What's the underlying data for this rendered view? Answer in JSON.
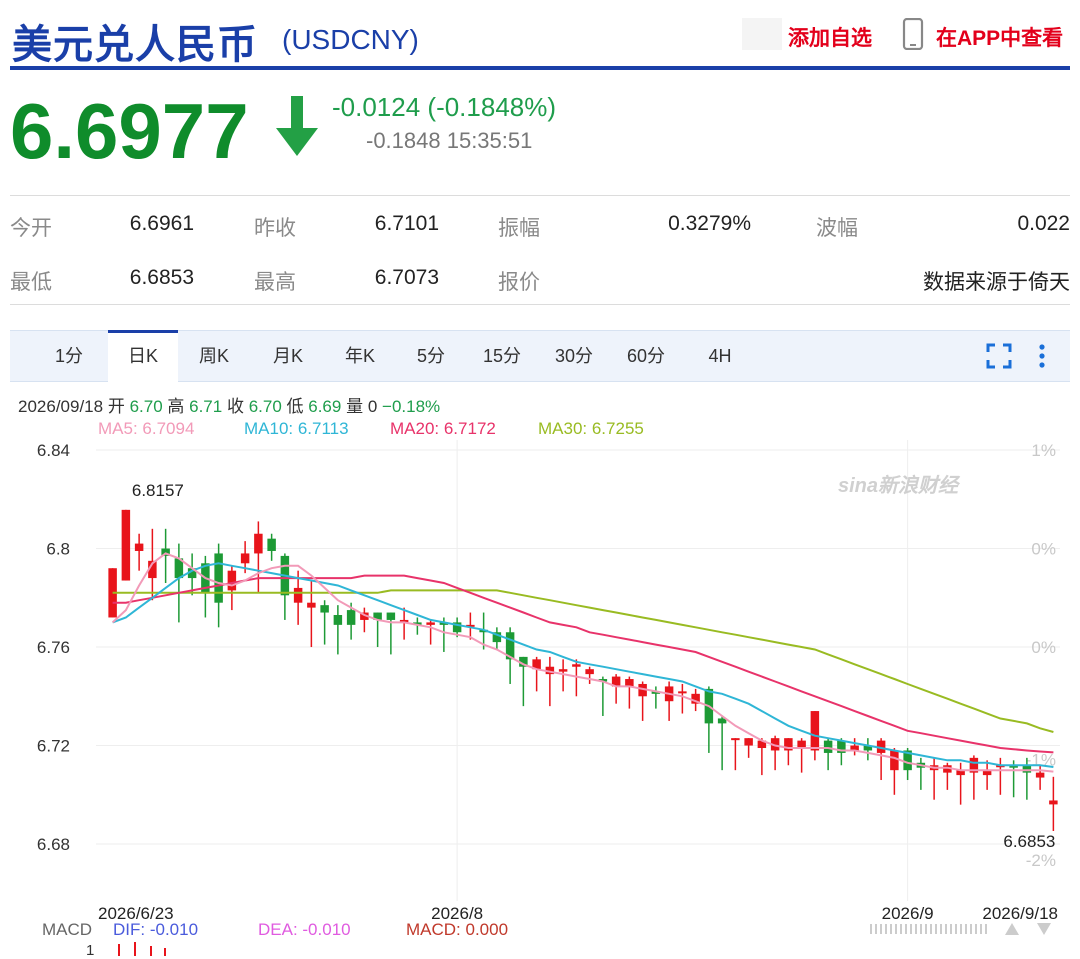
{
  "header": {
    "title": "美元兑人民币",
    "code": "(USDCNY)",
    "add_watchlist": "添加自选",
    "view_in_app": "在APP中查看"
  },
  "quote": {
    "price": "6.6977",
    "direction": "down",
    "change": "-0.0124 (-0.1848%)",
    "change2": "-0.1848 15:35:51"
  },
  "stats": {
    "open_label": "今开",
    "open": "6.6961",
    "prev_close_label": "昨收",
    "prev_close": "6.7101",
    "amplitude_label": "振幅",
    "amplitude": "0.3279%",
    "wave_label": "波幅",
    "wave": "0.022",
    "low_label": "最低",
    "low": "6.6853",
    "high_label": "最高",
    "high": "6.7073",
    "quote_label": "报价",
    "source": "数据来源于倚天"
  },
  "tabs": [
    "1分",
    "日K",
    "周K",
    "月K",
    "年K",
    "5分",
    "15分",
    "30分",
    "60分",
    "4H"
  ],
  "active_tab": "日K",
  "ohlc_bar": {
    "date": "2026/09/18",
    "open_label": "开",
    "open": "6.70",
    "high_label": "高",
    "high": "6.71",
    "close_label": "收",
    "close": "6.70",
    "low_label": "低",
    "low": "6.69",
    "vol_label": "量",
    "vol": "0",
    "pct": "−0.18%"
  },
  "ma_legend": {
    "ma5": "MA5: 6.7094",
    "ma10": "MA10: 6.7113",
    "ma20": "MA20: 6.7172",
    "ma30": "MA30: 6.7255"
  },
  "colors": {
    "up": "#e8141b",
    "down": "#1d9a35",
    "ma5": "#f29ab8",
    "ma10": "#2fb6d6",
    "ma20": "#e8336a",
    "ma30": "#99bb22",
    "brand": "#1a3fa8"
  },
  "chart_data": {
    "type": "candlestick",
    "y_ticks": [
      "6.84",
      "6.8",
      "6.76",
      "6.72",
      "6.68"
    ],
    "y_tick_values": [
      6.84,
      6.8,
      6.76,
      6.72,
      6.68
    ],
    "pct_ticks": [
      "1%",
      "0%",
      "0%",
      "-1%",
      "-2%"
    ],
    "ylim": [
      6.665,
      6.84
    ],
    "x_labels": [
      "2026/6/23",
      "2026/8",
      "2026/9",
      "2026/9/18"
    ],
    "max_annotation": "6.8157",
    "min_annotation": "6.6853",
    "watermark": "sina新浪财经",
    "candles": [
      {
        "d": "2026/6/23",
        "o": 6.772,
        "h": 6.792,
        "l": 6.772,
        "c": 6.792,
        "up": true
      },
      {
        "d": "",
        "o": 6.787,
        "h": 6.8157,
        "l": 6.787,
        "c": 6.8157,
        "up": true
      },
      {
        "d": "",
        "o": 6.799,
        "h": 6.806,
        "l": 6.791,
        "c": 6.802,
        "up": true
      },
      {
        "d": "",
        "o": 6.788,
        "h": 6.808,
        "l": 6.779,
        "c": 6.795,
        "up": true
      },
      {
        "d": "",
        "o": 6.8,
        "h": 6.808,
        "l": 6.786,
        "c": 6.797,
        "up": false
      },
      {
        "d": "",
        "o": 6.796,
        "h": 6.802,
        "l": 6.77,
        "c": 6.788,
        "up": false
      },
      {
        "d": "",
        "o": 6.792,
        "h": 6.798,
        "l": 6.781,
        "c": 6.788,
        "up": false
      },
      {
        "d": "",
        "o": 6.794,
        "h": 6.797,
        "l": 6.772,
        "c": 6.782,
        "up": false
      },
      {
        "d": "",
        "o": 6.798,
        "h": 6.802,
        "l": 6.768,
        "c": 6.778,
        "up": false
      },
      {
        "d": "",
        "o": 6.783,
        "h": 6.793,
        "l": 6.775,
        "c": 6.791,
        "up": true
      },
      {
        "d": "",
        "o": 6.798,
        "h": 6.803,
        "l": 6.79,
        "c": 6.794,
        "up": true
      },
      {
        "d": "",
        "o": 6.798,
        "h": 6.811,
        "l": 6.782,
        "c": 6.806,
        "up": true
      },
      {
        "d": "",
        "o": 6.804,
        "h": 6.806,
        "l": 6.795,
        "c": 6.799,
        "up": false
      },
      {
        "d": "",
        "o": 6.797,
        "h": 6.798,
        "l": 6.771,
        "c": 6.781,
        "up": false
      },
      {
        "d": "",
        "o": 6.778,
        "h": 6.791,
        "l": 6.769,
        "c": 6.784,
        "up": true
      },
      {
        "d": "",
        "o": 6.776,
        "h": 6.787,
        "l": 6.76,
        "c": 6.778,
        "up": true
      },
      {
        "d": "",
        "o": 6.777,
        "h": 6.779,
        "l": 6.761,
        "c": 6.774,
        "up": false
      },
      {
        "d": "",
        "o": 6.773,
        "h": 6.777,
        "l": 6.757,
        "c": 6.769,
        "up": false
      },
      {
        "d": "",
        "o": 6.775,
        "h": 6.778,
        "l": 6.763,
        "c": 6.769,
        "up": false
      },
      {
        "d": "",
        "o": 6.771,
        "h": 6.776,
        "l": 6.766,
        "c": 6.774,
        "up": true
      },
      {
        "d": "",
        "o": 6.774,
        "h": 6.774,
        "l": 6.76,
        "c": 6.771,
        "up": false
      },
      {
        "d": "",
        "o": 6.774,
        "h": 6.774,
        "l": 6.757,
        "c": 6.771,
        "up": false
      },
      {
        "d": "",
        "o": 6.77,
        "h": 6.776,
        "l": 6.763,
        "c": 6.771,
        "up": true
      },
      {
        "d": "",
        "o": 6.77,
        "h": 6.772,
        "l": 6.765,
        "c": 6.769,
        "up": false
      },
      {
        "d": "",
        "o": 6.77,
        "h": 6.771,
        "l": 6.761,
        "c": 6.769,
        "up": true
      },
      {
        "d": "",
        "o": 6.77,
        "h": 6.772,
        "l": 6.758,
        "c": 6.769,
        "up": false
      },
      {
        "d": "",
        "o": 6.77,
        "h": 6.772,
        "l": 6.764,
        "c": 6.766,
        "up": false
      },
      {
        "d": "",
        "o": 6.769,
        "h": 6.774,
        "l": 6.763,
        "c": 6.769,
        "up": true
      },
      {
        "d": "",
        "o": 6.767,
        "h": 6.774,
        "l": 6.759,
        "c": 6.766,
        "up": false
      },
      {
        "d": "",
        "o": 6.766,
        "h": 6.768,
        "l": 6.759,
        "c": 6.762,
        "up": false
      },
      {
        "d": "",
        "o": 6.766,
        "h": 6.768,
        "l": 6.745,
        "c": 6.755,
        "up": false
      },
      {
        "d": "",
        "o": 6.756,
        "h": 6.756,
        "l": 6.736,
        "c": 6.752,
        "up": false
      },
      {
        "d": "",
        "o": 6.755,
        "h": 6.756,
        "l": 6.742,
        "c": 6.751,
        "up": true
      },
      {
        "d": "",
        "o": 6.752,
        "h": 6.756,
        "l": 6.736,
        "c": 6.749,
        "up": true
      },
      {
        "d": "",
        "o": 6.751,
        "h": 6.755,
        "l": 6.742,
        "c": 6.75,
        "up": true
      },
      {
        "d": "",
        "o": 6.752,
        "h": 6.755,
        "l": 6.74,
        "c": 6.753,
        "up": true
      },
      {
        "d": "",
        "o": 6.751,
        "h": 6.752,
        "l": 6.745,
        "c": 6.749,
        "up": true
      },
      {
        "d": "",
        "o": 6.747,
        "h": 6.748,
        "l": 6.732,
        "c": 6.746,
        "up": false
      },
      {
        "d": "",
        "o": 6.744,
        "h": 6.749,
        "l": 6.737,
        "c": 6.748,
        "up": true
      },
      {
        "d": "",
        "o": 6.747,
        "h": 6.748,
        "l": 6.735,
        "c": 6.744,
        "up": true
      },
      {
        "d": "",
        "o": 6.745,
        "h": 6.746,
        "l": 6.73,
        "c": 6.74,
        "up": true
      },
      {
        "d": "",
        "o": 6.742,
        "h": 6.744,
        "l": 6.735,
        "c": 6.741,
        "up": false
      },
      {
        "d": "",
        "o": 6.744,
        "h": 6.746,
        "l": 6.73,
        "c": 6.738,
        "up": true
      },
      {
        "d": "",
        "o": 6.742,
        "h": 6.745,
        "l": 6.733,
        "c": 6.742,
        "up": true
      },
      {
        "d": "",
        "o": 6.741,
        "h": 6.743,
        "l": 6.734,
        "c": 6.737,
        "up": true
      },
      {
        "d": "",
        "o": 6.743,
        "h": 6.744,
        "l": 6.717,
        "c": 6.729,
        "up": false
      },
      {
        "d": "",
        "o": 6.731,
        "h": 6.732,
        "l": 6.71,
        "c": 6.729,
        "up": false
      },
      {
        "d": "",
        "o": 6.723,
        "h": 6.723,
        "l": 6.71,
        "c": 6.723,
        "up": true
      },
      {
        "d": "",
        "o": 6.723,
        "h": 6.723,
        "l": 6.715,
        "c": 6.72,
        "up": true
      },
      {
        "d": "",
        "o": 6.722,
        "h": 6.723,
        "l": 6.708,
        "c": 6.719,
        "up": true
      },
      {
        "d": "",
        "o": 6.723,
        "h": 6.724,
        "l": 6.71,
        "c": 6.718,
        "up": true
      },
      {
        "d": "",
        "o": 6.723,
        "h": 6.723,
        "l": 6.712,
        "c": 6.718,
        "up": true
      },
      {
        "d": "",
        "o": 6.722,
        "h": 6.723,
        "l": 6.709,
        "c": 6.719,
        "up": true
      },
      {
        "d": "",
        "o": 6.734,
        "h": 6.734,
        "l": 6.714,
        "c": 6.718,
        "up": true
      },
      {
        "d": "",
        "o": 6.722,
        "h": 6.723,
        "l": 6.71,
        "c": 6.717,
        "up": false
      },
      {
        "d": "",
        "o": 6.722,
        "h": 6.723,
        "l": 6.712,
        "c": 6.717,
        "up": false
      },
      {
        "d": "",
        "o": 6.72,
        "h": 6.723,
        "l": 6.716,
        "c": 6.718,
        "up": true
      },
      {
        "d": "",
        "o": 6.72,
        "h": 6.723,
        "l": 6.714,
        "c": 6.718,
        "up": false
      },
      {
        "d": "",
        "o": 6.722,
        "h": 6.723,
        "l": 6.706,
        "c": 6.717,
        "up": true
      },
      {
        "d": "",
        "o": 6.718,
        "h": 6.719,
        "l": 6.7,
        "c": 6.71,
        "up": true
      },
      {
        "d": "",
        "o": 6.718,
        "h": 6.719,
        "l": 6.706,
        "c": 6.71,
        "up": false
      },
      {
        "d": "",
        "o": 6.713,
        "h": 6.715,
        "l": 6.702,
        "c": 6.711,
        "up": false
      },
      {
        "d": "",
        "o": 6.712,
        "h": 6.715,
        "l": 6.698,
        "c": 6.71,
        "up": true
      },
      {
        "d": "",
        "o": 6.712,
        "h": 6.713,
        "l": 6.702,
        "c": 6.709,
        "up": true
      },
      {
        "d": "",
        "o": 6.71,
        "h": 6.713,
        "l": 6.696,
        "c": 6.708,
        "up": true
      },
      {
        "d": "",
        "o": 6.715,
        "h": 6.716,
        "l": 6.698,
        "c": 6.709,
        "up": true
      },
      {
        "d": "",
        "o": 6.71,
        "h": 6.714,
        "l": 6.702,
        "c": 6.708,
        "up": true
      },
      {
        "d": "",
        "o": 6.712,
        "h": 6.715,
        "l": 6.7,
        "c": 6.712,
        "up": true
      },
      {
        "d": "",
        "o": 6.712,
        "h": 6.714,
        "l": 6.699,
        "c": 6.711,
        "up": false
      },
      {
        "d": "",
        "o": 6.712,
        "h": 6.715,
        "l": 6.698,
        "c": 6.709,
        "up": false
      },
      {
        "d": "",
        "o": 6.709,
        "h": 6.712,
        "l": 6.702,
        "c": 6.707,
        "up": true
      },
      {
        "d": "2026/9/18",
        "o": 6.6977,
        "h": 6.7073,
        "l": 6.6853,
        "c": 6.6961,
        "up": true
      }
    ],
    "ma5": [
      6.77,
      6.775,
      6.785,
      6.794,
      6.798,
      6.796,
      6.792,
      6.788,
      6.786,
      6.785,
      6.787,
      6.79,
      6.792,
      6.793,
      6.793,
      6.789,
      6.784,
      6.779,
      6.776,
      6.773,
      6.771,
      6.77,
      6.77,
      6.769,
      6.768,
      6.766,
      6.765,
      6.764,
      6.761,
      6.759,
      6.756,
      6.753,
      6.751,
      6.75,
      6.749,
      6.748,
      6.747,
      6.746,
      6.744,
      6.744,
      6.743,
      6.742,
      6.741,
      6.74,
      6.738,
      6.736,
      6.732,
      6.728,
      6.725,
      6.722,
      6.72,
      6.719,
      6.719,
      6.719,
      6.719,
      6.718,
      6.718,
      6.717,
      6.716,
      6.715,
      6.713,
      6.712,
      6.711,
      6.711,
      6.71,
      6.71,
      6.71,
      6.71,
      6.71,
      6.71,
      6.71,
      6.7094
    ],
    "ma10": [
      6.77,
      6.772,
      6.776,
      6.78,
      6.784,
      6.788,
      6.791,
      6.793,
      6.794,
      6.793,
      6.792,
      6.791,
      6.79,
      6.789,
      6.788,
      6.787,
      6.786,
      6.785,
      6.783,
      6.781,
      6.779,
      6.777,
      6.775,
      6.773,
      6.771,
      6.77,
      6.769,
      6.768,
      6.767,
      6.765,
      6.763,
      6.761,
      6.759,
      6.758,
      6.756,
      6.754,
      6.753,
      6.752,
      6.751,
      6.75,
      6.749,
      6.748,
      6.747,
      6.746,
      6.744,
      6.742,
      6.741,
      6.739,
      6.737,
      6.734,
      6.731,
      6.728,
      6.726,
      6.724,
      6.723,
      6.722,
      6.721,
      6.72,
      6.719,
      6.718,
      6.717,
      6.716,
      6.715,
      6.714,
      6.714,
      6.713,
      6.713,
      6.712,
      6.712,
      6.712,
      6.712,
      6.7113
    ],
    "ma20": [
      6.778,
      6.778,
      6.779,
      6.78,
      6.781,
      6.782,
      6.783,
      6.784,
      6.785,
      6.786,
      6.787,
      6.788,
      6.788,
      6.788,
      6.788,
      6.788,
      6.788,
      6.788,
      6.788,
      6.789,
      6.789,
      6.789,
      6.789,
      6.788,
      6.787,
      6.786,
      6.784,
      6.782,
      6.78,
      6.778,
      6.776,
      6.774,
      6.772,
      6.77,
      6.769,
      6.768,
      6.766,
      6.765,
      6.764,
      6.763,
      6.762,
      6.761,
      6.76,
      6.759,
      6.758,
      6.756,
      6.754,
      6.752,
      6.75,
      6.748,
      6.746,
      6.744,
      6.742,
      6.74,
      6.738,
      6.736,
      6.734,
      6.732,
      6.73,
      6.728,
      6.726,
      6.725,
      6.724,
      6.723,
      6.722,
      6.721,
      6.72,
      6.719,
      6.7185,
      6.718,
      6.7176,
      6.7172
    ],
    "ma30": [
      6.782,
      6.782,
      6.782,
      6.782,
      6.782,
      6.782,
      6.782,
      6.782,
      6.782,
      6.782,
      6.782,
      6.782,
      6.782,
      6.782,
      6.782,
      6.782,
      6.782,
      6.782,
      6.782,
      6.782,
      6.782,
      6.783,
      6.783,
      6.783,
      6.783,
      6.783,
      6.783,
      6.783,
      6.783,
      6.783,
      6.782,
      6.781,
      6.78,
      6.779,
      6.778,
      6.777,
      6.776,
      6.775,
      6.774,
      6.773,
      6.772,
      6.771,
      6.77,
      6.769,
      6.768,
      6.767,
      6.766,
      6.765,
      6.764,
      6.763,
      6.762,
      6.761,
      6.76,
      6.759,
      6.757,
      6.755,
      6.753,
      6.751,
      6.749,
      6.747,
      6.745,
      6.743,
      6.741,
      6.739,
      6.737,
      6.735,
      6.733,
      6.731,
      6.73,
      6.729,
      6.727,
      6.7255
    ]
  },
  "macd": {
    "label": "MACD",
    "dif": "DIF: -0.010",
    "dea": "DEA: -0.010",
    "macd": "MACD: 0.000",
    "axis_tick": "1"
  }
}
